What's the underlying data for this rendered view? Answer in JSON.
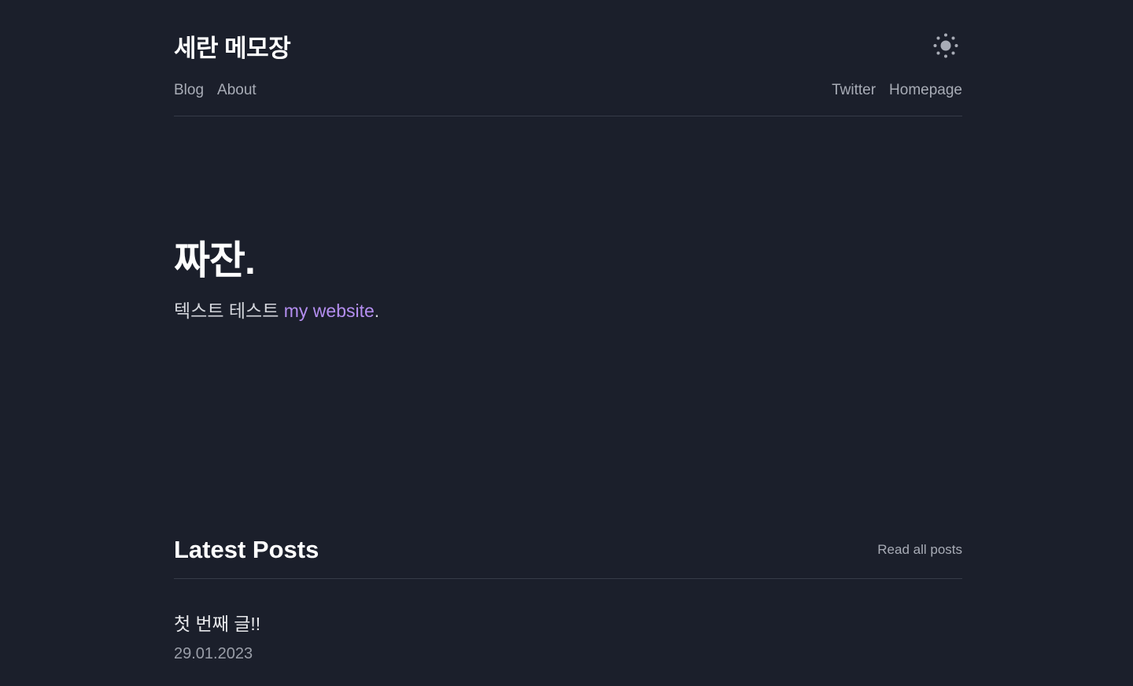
{
  "header": {
    "site_title": "세란 메모장",
    "theme_toggle_icon": "sun-icon"
  },
  "nav": {
    "left": [
      "Blog",
      "About"
    ],
    "right": [
      "Twitter",
      "Homepage"
    ]
  },
  "hero": {
    "title": "짜잔.",
    "text_prefix": "텍스트 테스트 ",
    "link_text": "my website",
    "text_suffix": "."
  },
  "latest_posts": {
    "heading": "Latest Posts",
    "read_all_label": "Read all posts",
    "posts": [
      {
        "title": "첫 번째 글!!",
        "date": "29.01.2023"
      }
    ]
  },
  "colors": {
    "background": "#1b1f2b",
    "accent_link": "#b48ef0",
    "muted_text": "#a8acb6",
    "divider": "#363b48"
  }
}
